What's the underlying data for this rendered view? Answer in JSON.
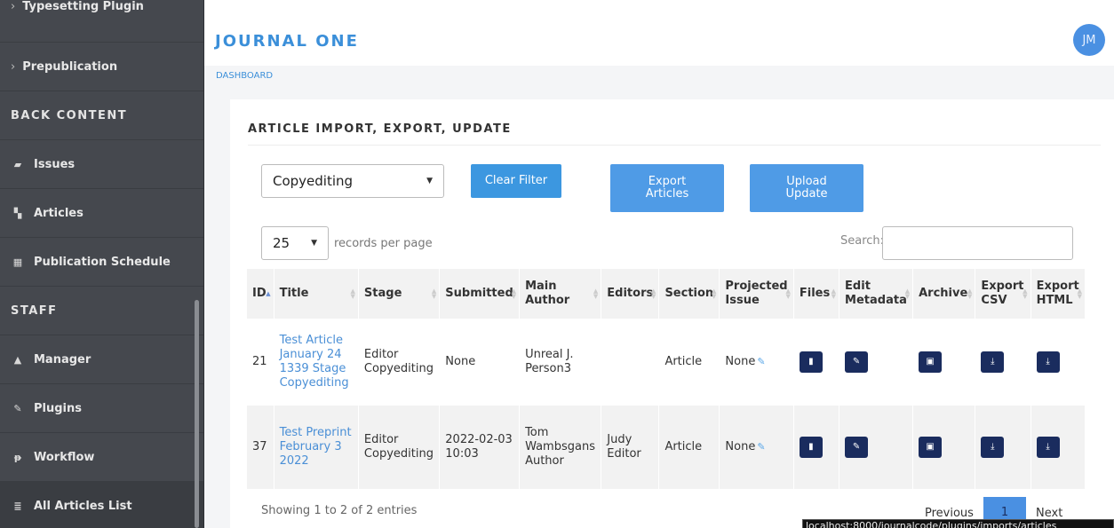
{
  "sidebar": {
    "items": [
      {
        "label": "Typesetting Plugin",
        "prefix": "›",
        "kind": "sub"
      },
      {
        "label": "Prepublication",
        "prefix": "›",
        "kind": "sub"
      },
      {
        "label": "BACK CONTENT",
        "kind": "section"
      },
      {
        "label": "Issues",
        "icon": "folder-open-icon",
        "glyph": "▰"
      },
      {
        "label": "Articles",
        "icon": "file-icon",
        "glyph": "▚"
      },
      {
        "label": "Publication Schedule",
        "icon": "calendar-icon",
        "glyph": "▦"
      },
      {
        "label": "STAFF",
        "kind": "section"
      },
      {
        "label": "Manager",
        "icon": "lock-icon",
        "glyph": "🔒"
      },
      {
        "label": "Plugins",
        "icon": "plug-icon",
        "glyph": "✎"
      },
      {
        "label": "Workflow",
        "icon": "workflow-icon",
        "glyph": "ᵽ"
      },
      {
        "label": "All Articles List",
        "icon": "list-icon",
        "glyph": "≣"
      }
    ]
  },
  "header": {
    "journal_title": "JOURNAL ONE",
    "avatar_initials": "JM"
  },
  "breadcrumb": "DASHBOARD",
  "card": {
    "title": "ARTICLE IMPORT, EXPORT, UPDATE",
    "stage_filter": "Copyediting",
    "clear_filter_label": "Clear Filter",
    "export_articles_label": "Export Articles",
    "upload_update_label": "Upload Update",
    "records_per_page_value": "25",
    "records_per_page_label": "records per page",
    "search_label": "Search:",
    "search_value": ""
  },
  "table": {
    "columns": [
      "ID",
      "Title",
      "Stage",
      "Submitted",
      "Main Author",
      "Editors",
      "Section",
      "Projected Issue",
      "Files",
      "Edit Metadata",
      "Archive",
      "Export CSV",
      "Export HTML"
    ],
    "rows": [
      {
        "id": "21",
        "title": "Test Article January 24 1339 Stage Copyediting",
        "stage": "Editor Copyediting",
        "submitted": "None",
        "author": "Unreal J. Person3",
        "editors": "",
        "section": "Article",
        "projected_issue": "None"
      },
      {
        "id": "37",
        "title": "Test Preprint February 3 2022",
        "stage": "Editor Copyediting",
        "submitted": "2022-02-03 10:03",
        "author": "Tom Wambsgans Author",
        "editors": "Judy Editor",
        "section": "Article",
        "projected_issue": "None"
      }
    ]
  },
  "footer": {
    "showing": "Showing 1 to 2 of 2 entries",
    "previous_label": "Previous",
    "current_page": "1",
    "next_label": "Next"
  },
  "status_url": "localhost:8000/journalcode/plugins/imports/articles"
}
